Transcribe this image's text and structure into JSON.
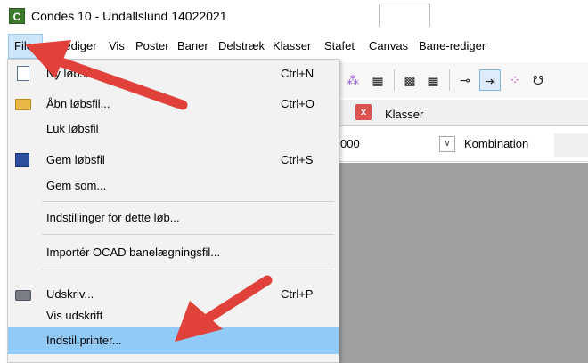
{
  "window": {
    "app_icon_letter": "C",
    "title": "Condes 10 - Undallslund 14022021"
  },
  "menubar": {
    "items": [
      "Filer",
      "Rediger",
      "Vis",
      "Poster",
      "Baner",
      "Delstræk",
      "Klasser",
      "Stafet",
      "Canvas",
      "Bane-rediger"
    ]
  },
  "file_menu": {
    "items": [
      {
        "label": "Ny løbsfil",
        "shortcut": "Ctrl+N",
        "icon": "new-file-icon"
      },
      {
        "label": "Åbn løbsfil...",
        "shortcut": "Ctrl+O",
        "icon": "open-folder-icon"
      },
      {
        "label": "Luk løbsfil",
        "shortcut": "",
        "icon": ""
      },
      {
        "label": "Gem løbsfil",
        "shortcut": "Ctrl+S",
        "icon": "save-icon"
      },
      {
        "label": "Gem som...",
        "shortcut": "",
        "icon": ""
      },
      {
        "label": "Indstillinger for dette løb...",
        "shortcut": "",
        "icon": ""
      },
      {
        "label": "Importér OCAD banelægningsfil...",
        "shortcut": "",
        "icon": ""
      },
      {
        "label": "Udskriv...",
        "shortcut": "Ctrl+P",
        "icon": "printer-icon"
      },
      {
        "label": "Vis udskrift",
        "shortcut": "",
        "icon": ""
      },
      {
        "label": "Indstil printer...",
        "shortcut": "",
        "icon": ""
      }
    ],
    "highlighted": "Indstil printer..."
  },
  "tabs": {
    "close_label": "x",
    "active_label": "Klasser"
  },
  "filterbar": {
    "value_fragment": "000",
    "combo_label": "Kombination"
  },
  "colors": {
    "menu_highlight": "#91c9f7",
    "menu_active": "#cce4f7",
    "arrow": "#e0413b",
    "canvas": "#a0a0a0"
  }
}
